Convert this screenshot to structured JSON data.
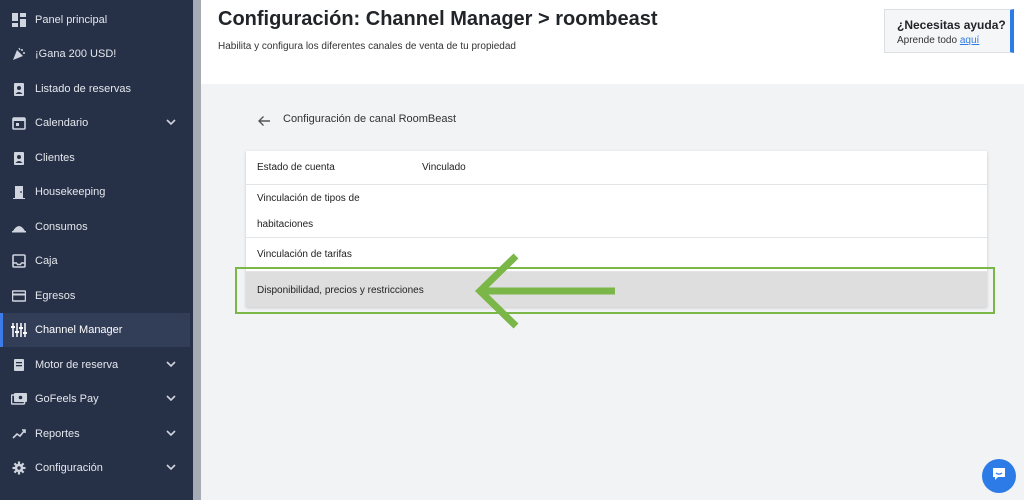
{
  "sidebar": {
    "items": [
      {
        "label": "Panel principal"
      },
      {
        "label": "¡Gana 200 USD!"
      },
      {
        "label": "Listado de reservas"
      },
      {
        "label": "Calendario"
      },
      {
        "label": "Clientes"
      },
      {
        "label": "Housekeeping"
      },
      {
        "label": "Consumos"
      },
      {
        "label": "Caja"
      },
      {
        "label": "Egresos"
      },
      {
        "label": "Channel Manager"
      },
      {
        "label": "Motor de reserva"
      },
      {
        "label": "GoFeels Pay"
      },
      {
        "label": "Reportes"
      },
      {
        "label": "Configuración"
      }
    ]
  },
  "header": {
    "title": "Configuración: Channel Manager > roombeast",
    "subtitle": "Habilita y configura los diferentes canales de venta de tu propiedad"
  },
  "help": {
    "title": "¿Necesitas ayuda?",
    "text": "Aprende todo",
    "link": "aquí"
  },
  "content": {
    "section_title": "Configuración de canal RoomBeast",
    "rows": [
      {
        "label": "Estado de cuenta",
        "value": "Vinculado"
      },
      {
        "label_line1": "Vinculación de tipos de",
        "label_line2": "habitaciones"
      },
      {
        "label": "Vinculación de tarifas"
      },
      {
        "label": "Disponibilidad, precios y restricciones"
      }
    ]
  },
  "colors": {
    "sidebar_bg": "#263046",
    "accent": "#2d7be6",
    "highlight_green": "#7ab648"
  }
}
